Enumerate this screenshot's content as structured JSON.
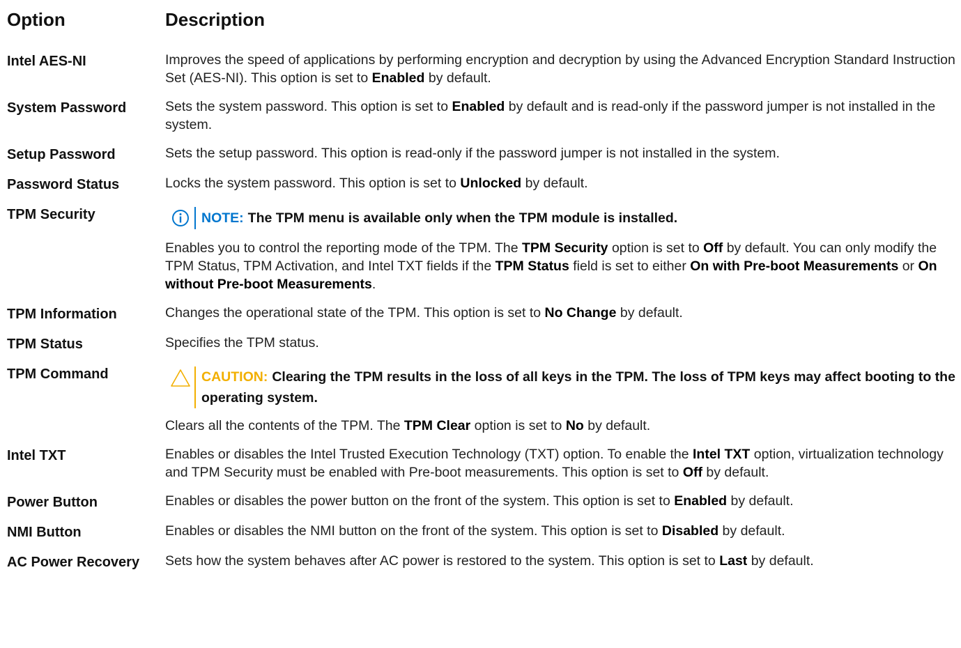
{
  "colors": {
    "note_accent": "#0076ce",
    "caution_accent": "#f2af00"
  },
  "header": {
    "option": "Option",
    "description": "Description"
  },
  "rows": {
    "aesni": {
      "option": "Intel AES-NI",
      "t1": "Improves the speed of applications by performing encryption and decryption by using the Advanced Encryption Standard Instruction Set (AES-NI). This option is set to ",
      "b1": "Enabled",
      "t2": " by default."
    },
    "syspw": {
      "option": "System Password",
      "t1": "Sets the system password. This option is set to ",
      "b1": "Enabled",
      "t2": " by default and is read-only if the password jumper is not installed in the system."
    },
    "setuppw": {
      "option": "Setup Password",
      "t1": "Sets the setup password. This option is read-only if the password jumper is not installed in the system."
    },
    "pwstatus": {
      "option": "Password Status",
      "t1": "Locks the system password. This option is set to ",
      "b1": "Unlocked",
      "t2": " by default."
    },
    "tpmsec": {
      "option": "TPM Security",
      "note_icon": "info-circle-icon",
      "note_label": "NOTE:",
      "note_text": "The TPM menu is available only when the TPM module is installed.",
      "t1": "Enables you to control the reporting mode of the TPM. The ",
      "b1": "TPM Security",
      "t2": " option is set to ",
      "b2": "Off",
      "t3": " by default. You can only modify the TPM Status, TPM Activation, and Intel TXT fields if the ",
      "b3": "TPM Status",
      "t4": " field is set to either ",
      "b4": "On with Pre-boot Measurements",
      "t5": " or ",
      "b5": "On without Pre-boot Measurements",
      "t6": "."
    },
    "tpminfo": {
      "option": "TPM Information",
      "t1": "Changes the operational state of the TPM. This option is set to ",
      "b1": "No Change",
      "t2": " by default."
    },
    "tpmstatus": {
      "option": "TPM Status",
      "t1": "Specifies the TPM status."
    },
    "tpmcmd": {
      "option": "TPM Command",
      "caution_icon": "warning-triangle-icon",
      "caution_label": "CAUTION:",
      "caution_text": "Clearing the TPM results in the loss of all keys in the TPM. The loss of TPM keys may affect booting to the operating system.",
      "t1": "Clears all the contents of the TPM. The ",
      "b1": "TPM Clear",
      "t2": " option is set to ",
      "b2": "No",
      "t3": " by default."
    },
    "txt": {
      "option": "Intel TXT",
      "t1": "Enables or disables the Intel Trusted Execution Technology (TXT) option. To enable the ",
      "b1": "Intel TXT",
      "t2": " option, virtualization technology and TPM Security must be enabled with Pre-boot measurements. This option is set to ",
      "b2": "Off",
      "t3": " by default."
    },
    "powerbtn": {
      "option": "Power Button",
      "t1": "Enables or disables the power button on the front of the system. This option is set to ",
      "b1": "Enabled",
      "t2": " by default."
    },
    "nmibtn": {
      "option": "NMI Button",
      "t1": "Enables or disables the NMI button on the front of the system. This option is set to ",
      "b1": "Disabled",
      "t2": " by default."
    },
    "acpower": {
      "option": "AC Power Recovery",
      "t1": "Sets how the system behaves after AC power is restored to the system. This option is set to ",
      "b1": "Last",
      "t2": " by default."
    }
  }
}
